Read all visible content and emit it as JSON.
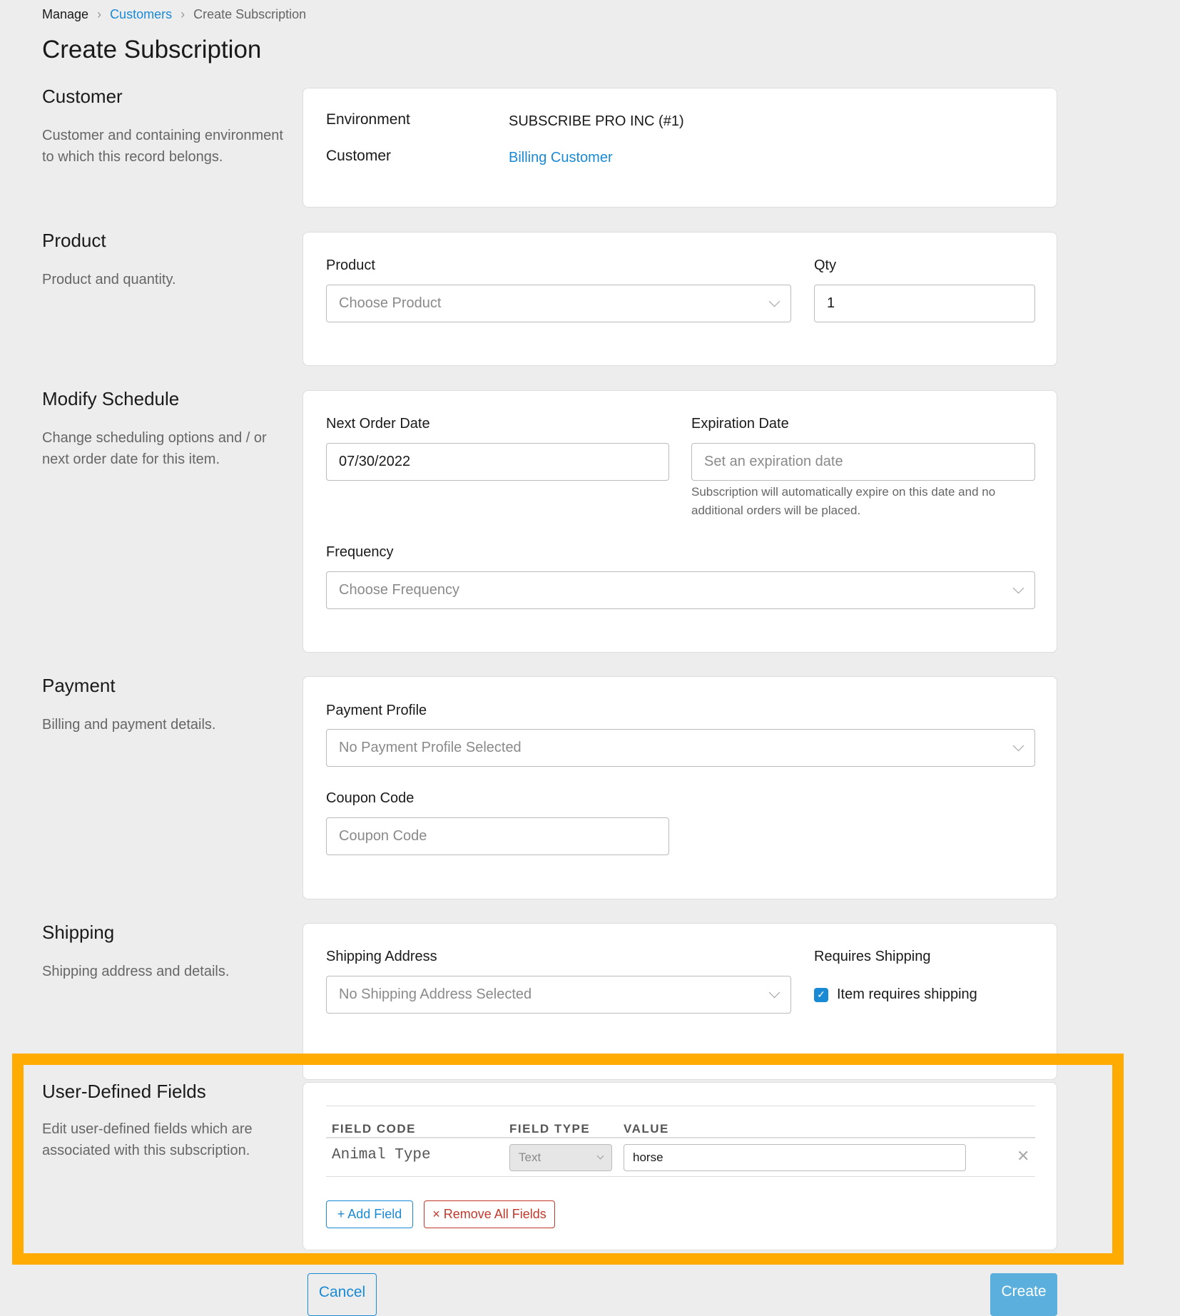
{
  "breadcrumb": {
    "items": [
      "Manage",
      "Customers",
      "Create Subscription"
    ]
  },
  "title": "Create Subscription",
  "sections": {
    "customer": {
      "title": "Customer",
      "desc": "Customer and containing environment to which this record belongs.",
      "env_label": "Environment",
      "env_value": "SUBSCRIBE PRO INC (#1)",
      "cust_label": "Customer",
      "cust_value": "Billing Customer"
    },
    "product": {
      "title": "Product",
      "desc": "Product and quantity.",
      "product_label": "Product",
      "product_placeholder": "Choose Product",
      "qty_label": "Qty",
      "qty_value": "1"
    },
    "schedule": {
      "title": "Modify Schedule",
      "desc": "Change scheduling options and / or next order date for this item.",
      "next_label": "Next Order Date",
      "next_value": "07/30/2022",
      "exp_label": "Expiration Date",
      "exp_placeholder": "Set an expiration date",
      "exp_help": "Subscription will automatically expire on this date and no additional orders will be placed.",
      "freq_label": "Frequency",
      "freq_placeholder": "Choose Frequency"
    },
    "payment": {
      "title": "Payment",
      "desc": "Billing and payment details.",
      "profile_label": "Payment Profile",
      "profile_placeholder": "No Payment Profile Selected",
      "coupon_label": "Coupon Code",
      "coupon_placeholder": "Coupon Code"
    },
    "shipping": {
      "title": "Shipping",
      "desc": "Shipping address and details.",
      "address_label": "Shipping Address",
      "address_placeholder": "No Shipping Address Selected",
      "requires_label": "Requires Shipping",
      "requires_checkbox": "Item requires shipping",
      "requires_checked": true
    },
    "udf": {
      "title": "User-Defined Fields",
      "desc": "Edit user-defined fields which are associated with this subscription.",
      "headers": [
        "FIELD CODE",
        "FIELD TYPE",
        "VALUE"
      ],
      "rows": [
        {
          "code": "Animal Type",
          "type": "Text",
          "value": "horse"
        }
      ],
      "add": "+ Add Field",
      "remove": "× Remove All Fields"
    }
  },
  "actions": {
    "cancel": "Cancel",
    "create": "Create"
  },
  "colors": {
    "accent": "#1a8ad4",
    "highlight": "#ffab00",
    "danger": "#c0392b",
    "create_bg": "#5aafdc"
  }
}
